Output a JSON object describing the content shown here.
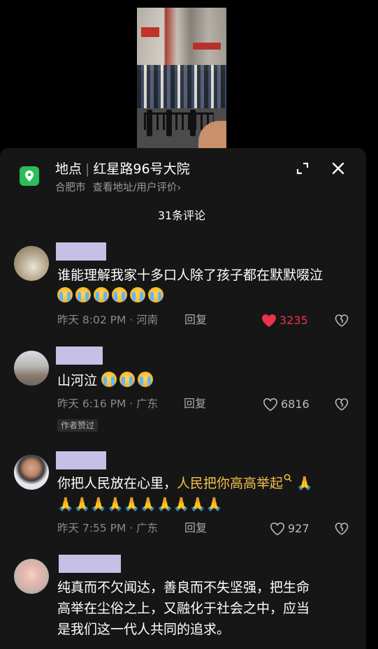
{
  "location": {
    "label": "地点",
    "name": "红星路96号大院",
    "city": "合肥市",
    "link": "查看地址/用户评价",
    "chevron": "›"
  },
  "comment_count": "31条评论",
  "icons": {
    "location": "location-pin-icon",
    "expand": "expand-icon",
    "close": "close-icon",
    "like": "heart-icon",
    "dislike": "broken-heart-icon",
    "search": "search-icon"
  },
  "colors": {
    "accent_green": "#2dbb5b",
    "liked_red": "#e8334b",
    "highlight": "#f2c14a",
    "name_placeholder": "#c6bfe6"
  },
  "comments": [
    {
      "text": "谁能理解我家十多口人除了孩子都在默默啜泣",
      "emoji_count": 6,
      "meta": "昨天 8:02 PM · 河南",
      "reply": "回复",
      "likes": "3235",
      "liked": true
    },
    {
      "text": "山河泣",
      "emoji_count": 3,
      "meta": "昨天 6:16 PM · 广东",
      "reply": "回复",
      "likes": "6816",
      "liked": false,
      "badge": "作者赞过"
    },
    {
      "text_plain": "你把人民放在心里，",
      "text_highlight": "人民把你高高举起",
      "pray": "🙏",
      "pray_line": "🙏🙏🙏🙏🙏🙏🙏🙏🙏🙏",
      "meta": "昨天 7:55 PM · 广东",
      "reply": "回复",
      "likes": "927",
      "liked": false
    },
    {
      "line1": "纯真而不欠闻达，善良而不失坚强，把生命",
      "line2": "高举在尘俗之上，又融化于社会之中，应当",
      "line3": "是我们这一代人共同的追求。"
    }
  ]
}
